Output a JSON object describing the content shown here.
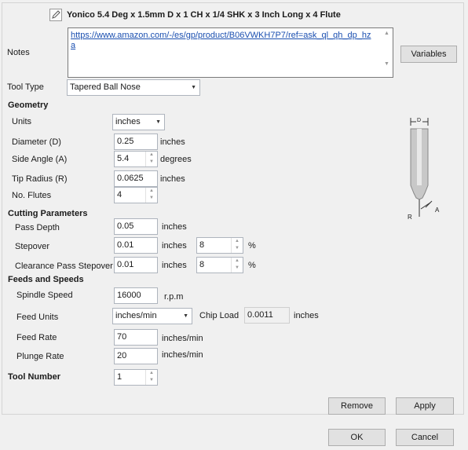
{
  "header": {
    "title": "Yonico 5.4 Deg x 1.5mm D x 1 CH x 1/4 SHK x 3 Inch Long x 4 Flute",
    "edit_icon": "pencil-icon"
  },
  "notes": {
    "label": "Notes",
    "url": "https://www.amazon.com/-/es/gp/product/B06VWKH7P7/ref=ask_ql_qh_dp_hza",
    "variables_button": "Variables"
  },
  "tool_type": {
    "label": "Tool Type",
    "value": "Tapered Ball Nose"
  },
  "geometry": {
    "heading": "Geometry",
    "units_label": "Units",
    "units_value": "inches",
    "diameter_label": "Diameter (D)",
    "diameter_value": "0.25",
    "diameter_unit": "inches",
    "side_angle_label": "Side Angle (A)",
    "side_angle_value": "5.4",
    "side_angle_unit": "degrees",
    "tip_radius_label": "Tip Radius (R)",
    "tip_radius_value": "0.0625",
    "tip_radius_unit": "inches",
    "flutes_label": "No. Flutes",
    "flutes_value": "4"
  },
  "diagram": {
    "d_label": "D",
    "r_label": "R",
    "a_label": "A"
  },
  "cutting": {
    "heading": "Cutting Parameters",
    "pass_depth_label": "Pass Depth",
    "pass_depth_value": "0.05",
    "pass_depth_unit": "inches",
    "stepover_label": "Stepover",
    "stepover_value": "0.01",
    "stepover_unit": "inches",
    "stepover_pct": "8",
    "pct_sign": "%",
    "clearance_label": "Clearance Pass Stepover",
    "clearance_value": "0.01",
    "clearance_unit": "inches",
    "clearance_pct": "8",
    "clearance_pct_sign": "%"
  },
  "feeds": {
    "heading": "Feeds and Speeds",
    "spindle_label": "Spindle Speed",
    "spindle_value": "16000",
    "spindle_unit": "r.p.m",
    "feed_units_label": "Feed Units",
    "feed_units_value": "inches/min",
    "chip_load_label": "Chip Load",
    "chip_load_value": "0.0011",
    "chip_load_unit": "inches",
    "feed_rate_label": "Feed Rate",
    "feed_rate_value": "70",
    "feed_rate_unit": "inches/min",
    "plunge_label": "Plunge Rate",
    "plunge_value": "20",
    "plunge_unit": "inches/min"
  },
  "tool_number": {
    "label": "Tool Number",
    "value": "1"
  },
  "buttons": {
    "remove": "Remove",
    "apply": "Apply",
    "ok": "OK",
    "cancel": "Cancel"
  }
}
